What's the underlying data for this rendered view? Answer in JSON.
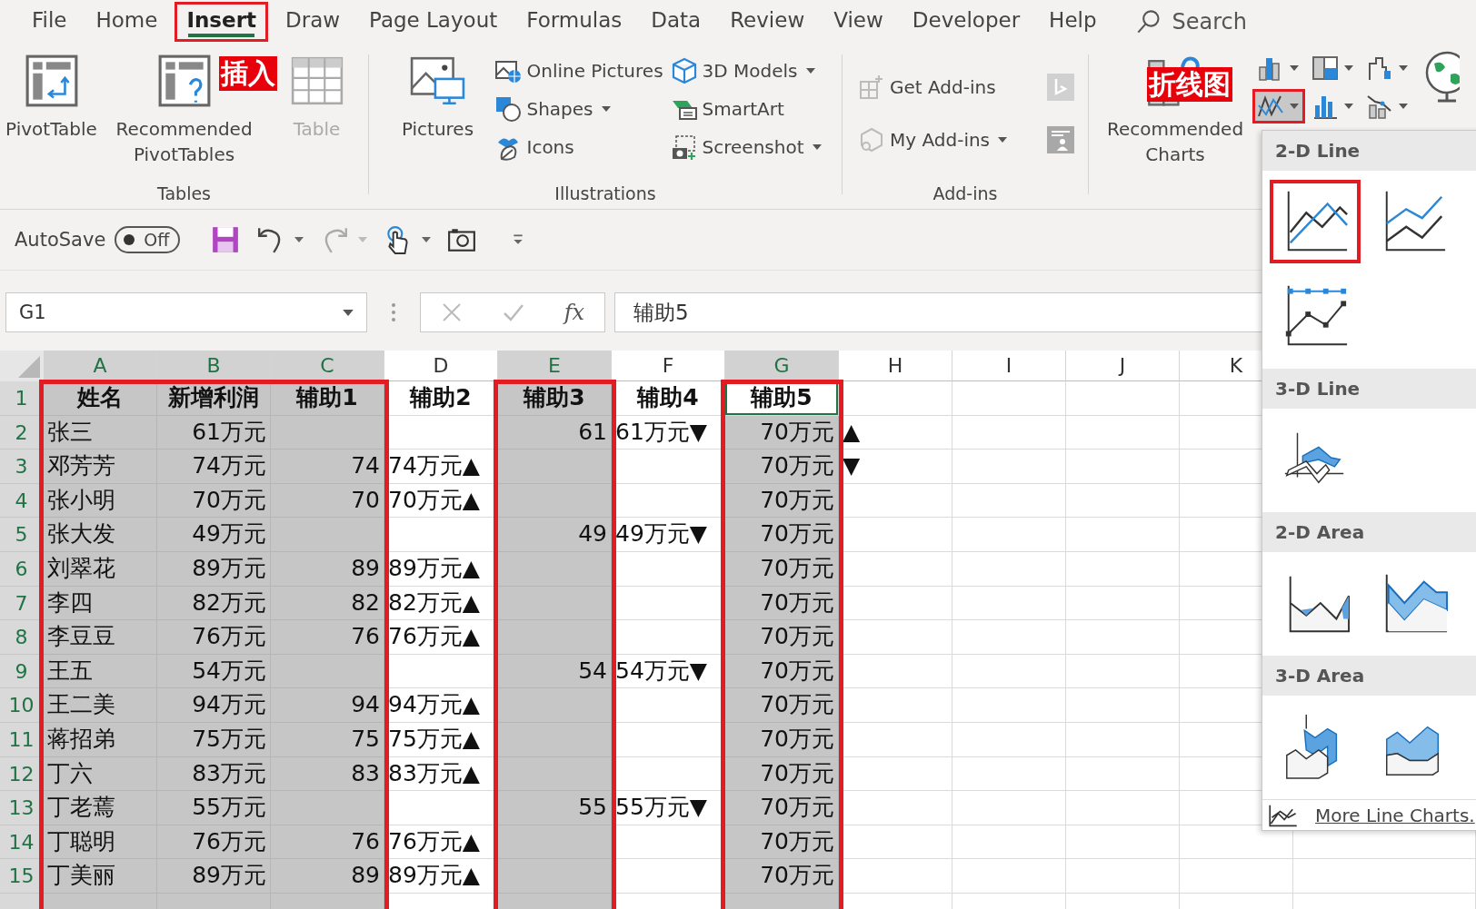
{
  "tabs": [
    {
      "label": "File",
      "selected": false,
      "highlighted": false
    },
    {
      "label": "Home",
      "selected": false,
      "highlighted": false
    },
    {
      "label": "Insert",
      "selected": true,
      "highlighted": true
    },
    {
      "label": "Draw",
      "selected": false,
      "highlighted": false
    },
    {
      "label": "Page Layout",
      "selected": false,
      "highlighted": false
    },
    {
      "label": "Formulas",
      "selected": false,
      "highlighted": false
    },
    {
      "label": "Data",
      "selected": false,
      "highlighted": false
    },
    {
      "label": "Review",
      "selected": false,
      "highlighted": false
    },
    {
      "label": "View",
      "selected": false,
      "highlighted": false
    },
    {
      "label": "Developer",
      "selected": false,
      "highlighted": false
    },
    {
      "label": "Help",
      "selected": false,
      "highlighted": false
    }
  ],
  "search": {
    "placeholder": "Search"
  },
  "ribbon": {
    "tables": {
      "label": "Tables",
      "buttons": [
        {
          "label": "PivotTable",
          "disabled": false
        },
        {
          "label": "Recommended PivotTables",
          "disabled": false
        },
        {
          "label": "Table",
          "disabled": true
        }
      ]
    },
    "illustrations": {
      "label": "Illustrations",
      "pictures": {
        "label": "Pictures"
      },
      "buttons": [
        {
          "label": "Online Pictures",
          "menu": false
        },
        {
          "label": "Shapes",
          "menu": true
        },
        {
          "label": "Icons",
          "menu": false
        },
        {
          "label": "3D Models",
          "menu": true
        },
        {
          "label": "SmartArt",
          "menu": false
        },
        {
          "label": "Screenshot",
          "menu": true
        }
      ]
    },
    "addins": {
      "label": "Add-ins",
      "buttons": [
        {
          "label": "Get Add-ins",
          "disabled": true,
          "menu": false
        },
        {
          "label": "My Add-ins",
          "disabled": true,
          "menu": true
        }
      ]
    },
    "charts": {
      "recommended": {
        "label": "Recommended Charts"
      },
      "buttons": [
        {
          "pressed": false,
          "highlighted": false
        },
        {
          "pressed": false,
          "highlighted": false
        },
        {
          "pressed": false,
          "highlighted": false
        },
        {
          "pressed": true,
          "highlighted": true
        },
        {
          "pressed": false,
          "highlighted": false
        },
        {
          "pressed": false,
          "highlighted": false
        }
      ]
    }
  },
  "annotations": [
    {
      "text": "插入"
    },
    {
      "text": "折线图"
    }
  ],
  "quick_access": {
    "autosave_label": "AutoSave",
    "autosave_toggle": {
      "on": false,
      "label": "Off"
    }
  },
  "formula_bar": {
    "name_box": "G1",
    "fx": "fx",
    "value": "辅助5"
  },
  "sheet": {
    "columns": [
      {
        "letter": "A",
        "selected": true,
        "boxed": true,
        "active": false
      },
      {
        "letter": "B",
        "selected": true,
        "boxed": true,
        "active": false
      },
      {
        "letter": "C",
        "selected": true,
        "boxed": true,
        "active": false
      },
      {
        "letter": "D",
        "selected": false,
        "boxed": false,
        "active": false
      },
      {
        "letter": "E",
        "selected": true,
        "boxed": true,
        "active": false
      },
      {
        "letter": "F",
        "selected": false,
        "boxed": false,
        "active": false
      },
      {
        "letter": "G",
        "selected": true,
        "boxed": true,
        "active": true
      },
      {
        "letter": "H",
        "selected": false,
        "boxed": false,
        "active": false
      },
      {
        "letter": "I",
        "selected": false,
        "boxed": false,
        "active": false
      },
      {
        "letter": "J",
        "selected": false,
        "boxed": false,
        "active": false
      },
      {
        "letter": "K",
        "selected": false,
        "boxed": false,
        "active": false
      }
    ],
    "rows": [
      {
        "number": "1",
        "active": true,
        "cells": [
          "姓名",
          "新增利润",
          "辅助1",
          "辅助2",
          "辅助3",
          "辅助4",
          "辅助5",
          null
        ]
      },
      {
        "number": "2",
        "active": false,
        "cells": [
          "张三",
          "61万元",
          null,
          null,
          "61",
          "61万元▼",
          "70万元",
          "▲"
        ]
      },
      {
        "number": "3",
        "active": false,
        "cells": [
          "邓芳芳",
          "74万元",
          "74",
          "74万元▲",
          null,
          null,
          "70万元",
          "▼"
        ]
      },
      {
        "number": "4",
        "active": false,
        "cells": [
          "张小明",
          "70万元",
          "70",
          "70万元▲",
          null,
          null,
          "70万元",
          null
        ]
      },
      {
        "number": "5",
        "active": false,
        "cells": [
          "张大发",
          "49万元",
          null,
          null,
          "49",
          "49万元▼",
          "70万元",
          null
        ]
      },
      {
        "number": "6",
        "active": false,
        "cells": [
          "刘翠花",
          "89万元",
          "89",
          "89万元▲",
          null,
          null,
          "70万元",
          null
        ]
      },
      {
        "number": "7",
        "active": false,
        "cells": [
          "李四",
          "82万元",
          "82",
          "82万元▲",
          null,
          null,
          "70万元",
          null
        ]
      },
      {
        "number": "8",
        "active": false,
        "cells": [
          "李豆豆",
          "76万元",
          "76",
          "76万元▲",
          null,
          null,
          "70万元",
          null
        ]
      },
      {
        "number": "9",
        "active": false,
        "cells": [
          "王五",
          "54万元",
          null,
          null,
          "54",
          "54万元▼",
          "70万元",
          null
        ]
      },
      {
        "number": "10",
        "active": false,
        "cells": [
          "王二美",
          "94万元",
          "94",
          "94万元▲",
          null,
          null,
          "70万元",
          null
        ]
      },
      {
        "number": "11",
        "active": false,
        "cells": [
          "蒋招弟",
          "75万元",
          "75",
          "75万元▲",
          null,
          null,
          "70万元",
          null
        ]
      },
      {
        "number": "12",
        "active": false,
        "cells": [
          "丁六",
          "83万元",
          "83",
          "83万元▲",
          null,
          null,
          "70万元",
          null
        ]
      },
      {
        "number": "13",
        "active": false,
        "cells": [
          "丁老蔫",
          "55万元",
          null,
          null,
          "55",
          "55万元▼",
          "70万元",
          null
        ]
      },
      {
        "number": "14",
        "active": false,
        "cells": [
          "丁聪明",
          "76万元",
          "76",
          "76万元▲",
          null,
          null,
          "70万元",
          null
        ]
      },
      {
        "number": "15",
        "active": false,
        "cells": [
          "丁美丽",
          "89万元",
          "89",
          "89万元▲",
          null,
          null,
          "70万元",
          null
        ]
      }
    ]
  },
  "line_menu": {
    "sections": [
      {
        "title": "2-D Line",
        "options": [
          {
            "kind": "line",
            "highlighted": true
          },
          {
            "kind": "stacked-line",
            "highlighted": false
          },
          {
            "kind": "line-markers",
            "highlighted": false
          }
        ]
      },
      {
        "title": "3-D Line",
        "options": [
          {
            "kind": "line-3d",
            "highlighted": false
          }
        ]
      },
      {
        "title": "2-D Area",
        "options": [
          {
            "kind": "area",
            "highlighted": false
          },
          {
            "kind": "stacked-area",
            "highlighted": false
          }
        ]
      },
      {
        "title": "3-D Area",
        "options": [
          {
            "kind": "area-3d",
            "highlighted": false
          },
          {
            "kind": "stacked-area-3d",
            "highlighted": false
          }
        ]
      }
    ],
    "more": "More Line Charts."
  }
}
